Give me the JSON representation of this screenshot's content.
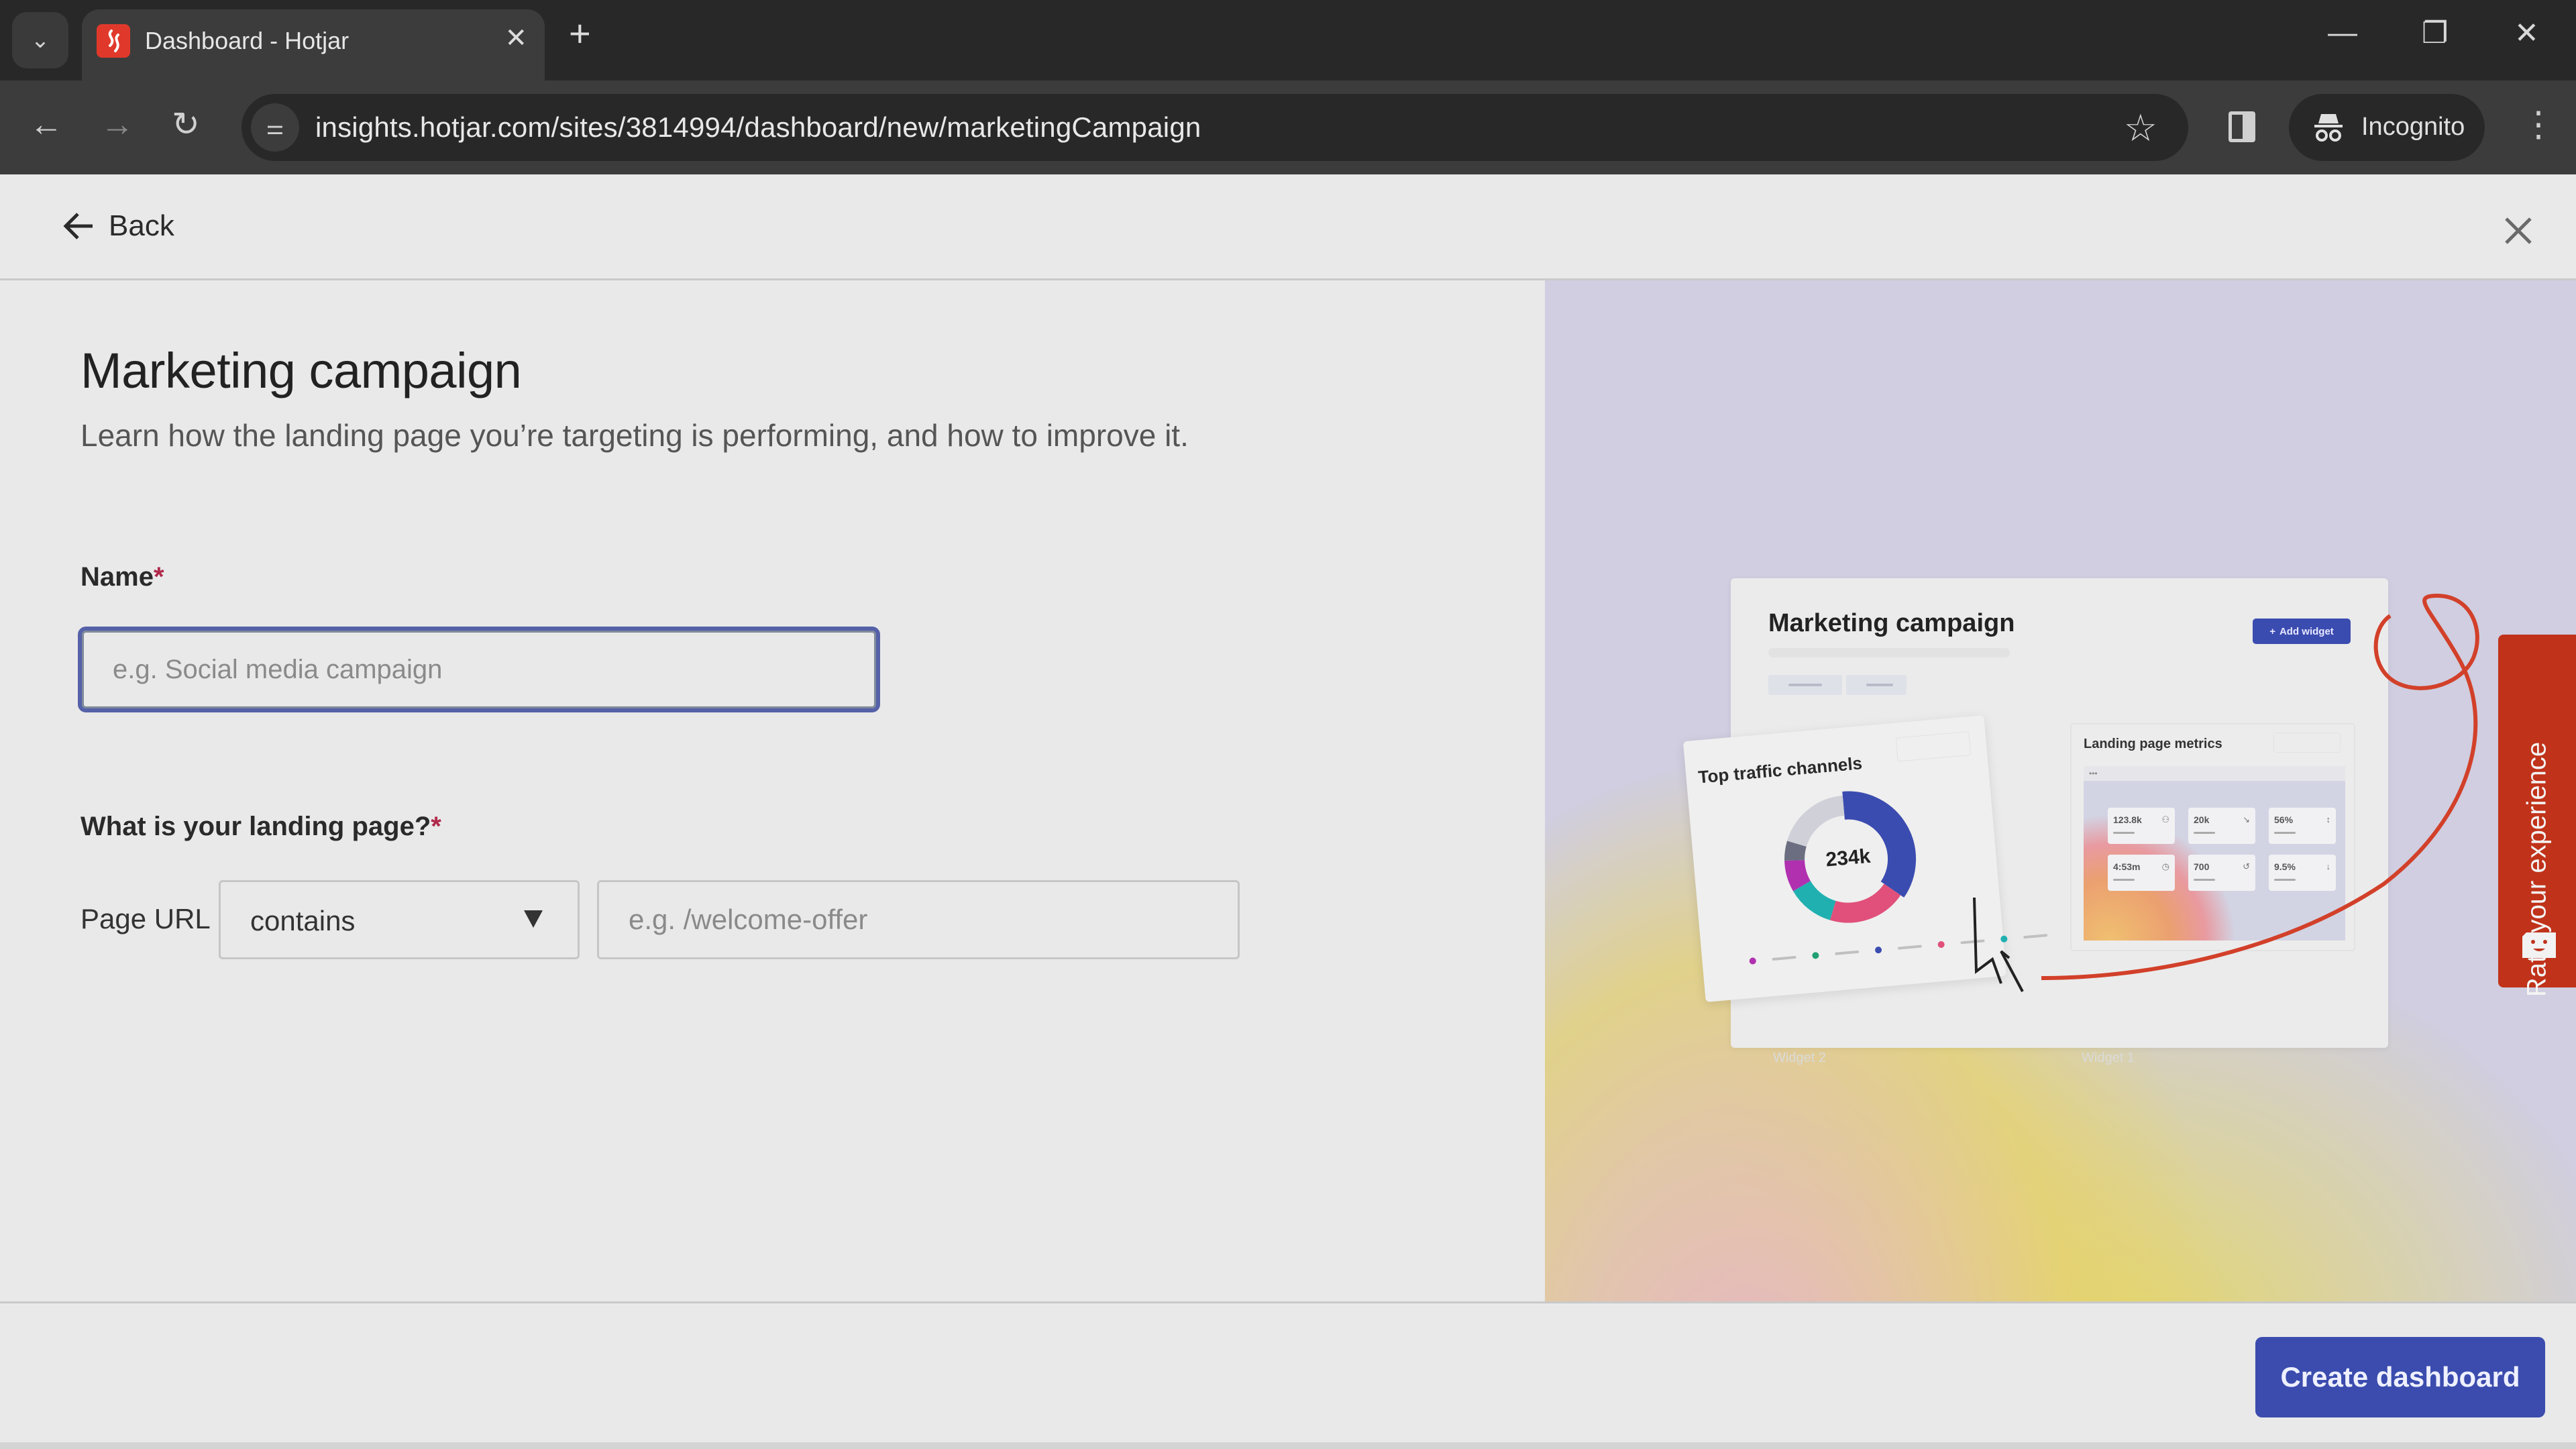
{
  "browser": {
    "tab_title": "Dashboard - Hotjar",
    "url": "insights.hotjar.com/sites/3814994/dashboard/new/marketingCampaign",
    "incognito_label": "Incognito",
    "icons": {
      "tab_search": "chevron-down-icon",
      "tab_close": "close-icon",
      "new_tab": "plus-icon",
      "minimize": "minimize-icon",
      "restore": "restore-icon",
      "window_close": "close-icon",
      "back": "arrow-left-icon",
      "forward": "arrow-right-icon",
      "reload": "reload-icon",
      "site_info": "tune-icon",
      "bookmark": "star-icon",
      "side_panel": "side-panel-icon",
      "incognito": "incognito-icon",
      "menu": "kebab-icon"
    },
    "glyphs": {
      "tab_search": "⌄",
      "tab_close": "✕",
      "new_tab": "+",
      "minimize": "—",
      "restore": "❐",
      "window_close": "✕",
      "back": "←",
      "forward": "→",
      "reload": "↻",
      "site_info": "⚌",
      "bookmark": "☆",
      "menu": "⋮"
    }
  },
  "header": {
    "back_label": "Back"
  },
  "form": {
    "title": "Marketing campaign",
    "subtitle": "Learn how the landing page you’re targeting is performing, and how to improve it.",
    "name_label": "Name",
    "required_mark": "*",
    "name_placeholder": "e.g. Social media campaign",
    "name_value": "",
    "landing_label": "What is your landing page?",
    "page_url_label": "Page URL",
    "match_select_value": "contains",
    "url_placeholder": "e.g. /welcome-offer",
    "url_value": ""
  },
  "illustration": {
    "title": "Marketing campaign",
    "add_widget_label": "Add widget",
    "traffic_title": "Top traffic channels",
    "traffic_total": "234k",
    "traffic_segments": [
      {
        "color": "#3b4cb0",
        "share": 0.36
      },
      {
        "color": "#e0507a",
        "share": 0.2
      },
      {
        "color": "#20b0b0",
        "share": 0.12
      },
      {
        "color": "#b030b0",
        "share": 0.08
      },
      {
        "color": "#6a6e80",
        "share": 0.05
      },
      {
        "color": "#cfd0d8",
        "share": 0.19
      }
    ],
    "legend_colors": [
      "#b030b0",
      "#20a070",
      "#3b4cb0",
      "#e0507a",
      "#20b0b0"
    ],
    "metrics_title": "Landing page metrics",
    "metrics": [
      {
        "value": "123.8k",
        "icon": "users-icon",
        "glyph": "⚇"
      },
      {
        "value": "20k",
        "icon": "click-icon",
        "glyph": "↘"
      },
      {
        "value": "56%",
        "icon": "scroll-icon",
        "glyph": "↕"
      },
      {
        "value": "4:53m",
        "icon": "clock-icon",
        "glyph": "◷"
      },
      {
        "value": "700",
        "icon": "rage-click-icon",
        "glyph": "↺"
      },
      {
        "value": "9.5%",
        "icon": "drop-off-icon",
        "glyph": "↓"
      }
    ],
    "widget_ghost_1": "Widget 2",
    "widget_ghost_2": "Widget 1"
  },
  "feedback": {
    "label": "Rate your experience"
  },
  "footer": {
    "create_label": "Create dashboard"
  },
  "colors": {
    "primary": "#3b4cae",
    "feedback": "#c0321a",
    "required": "#b0284a"
  }
}
